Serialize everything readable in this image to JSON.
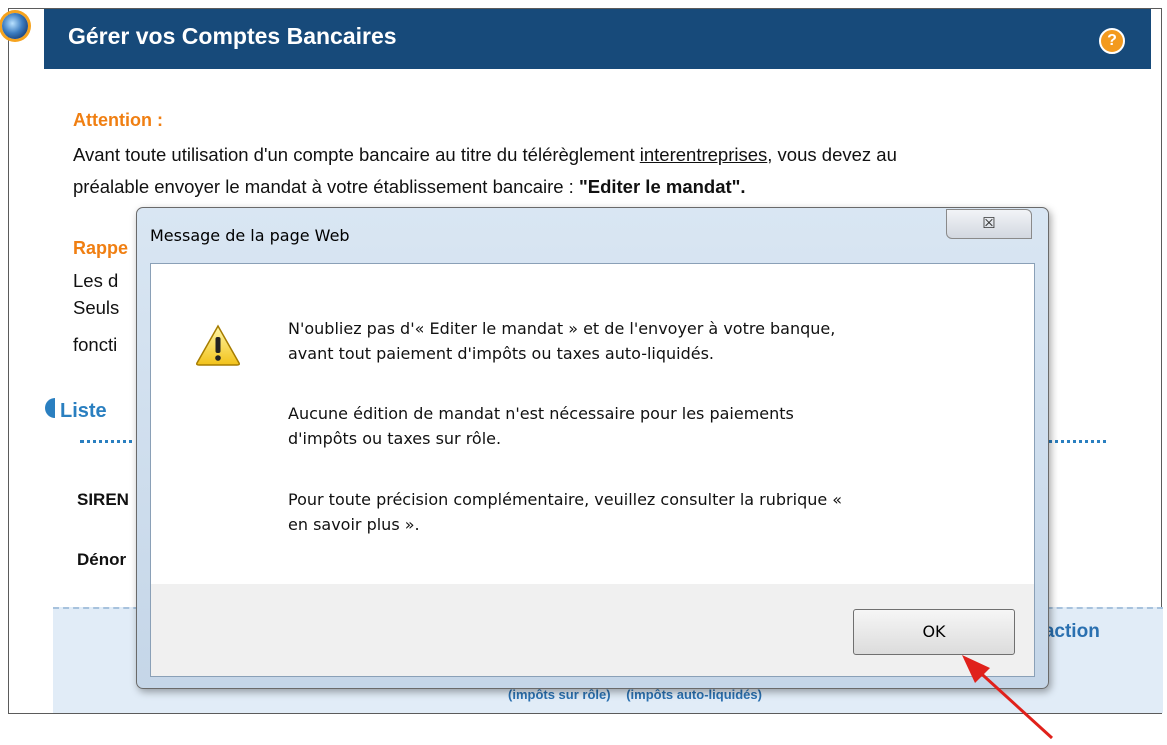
{
  "header": {
    "title": "Gérer vos Comptes Bancaires",
    "help_label": "?"
  },
  "content": {
    "attention_heading": "Attention :",
    "attention_line1_a": "Avant toute utilisation d'un compte bancaire au titre du télérèglement ",
    "attention_link": "interentreprises",
    "attention_line1_b": ", vous devez au",
    "attention_line2_a": "préalable envoyer le mandat à votre établissement bancaire : ",
    "attention_line2_bold": "\"Editer le mandat\".",
    "rappel_fragment": "Rappe",
    "line_les": "Les d",
    "line_seuls": "Seuls",
    "line_fonct": "foncti",
    "liste_fragment": "Liste",
    "siren_fragment": "SIREN",
    "denom_fragment": "Dénor",
    "action_fragment": "e action",
    "link_role": "(impôts sur rôle)",
    "link_auto": "(impôts auto-liquidés)"
  },
  "dialog": {
    "title": "Message de la page Web",
    "close_label": "☒",
    "msg1_line1": "N'oubliez pas d'« Editer le mandat » et de l'envoyer à votre banque,",
    "msg1_line2": "avant tout paiement d'impôts ou taxes auto-liquidés.",
    "msg2_line1": "Aucune édition de mandat n'est nécessaire pour les paiements",
    "msg2_line2": "d'impôts ou taxes sur rôle.",
    "msg3_line1": "Pour toute précision complémentaire, veuillez consulter la rubrique «",
    "msg3_line2": "en savoir plus ».",
    "ok_label": "OK"
  },
  "colors": {
    "header_bg": "#174a7a",
    "accent_orange": "#f07f12",
    "link_blue": "#2a7fc0",
    "arrow_red": "#e0211b"
  }
}
